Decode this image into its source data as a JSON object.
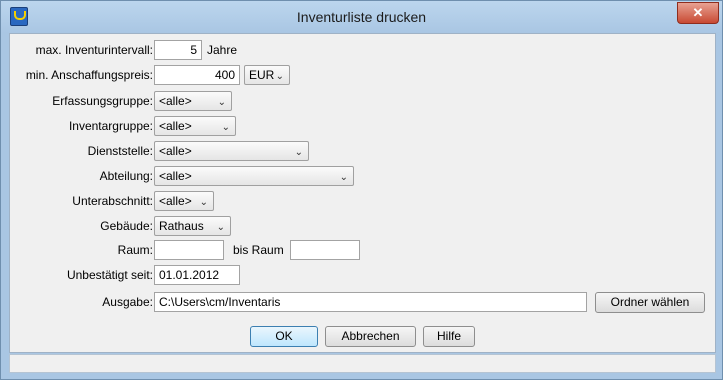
{
  "window": {
    "title": "Inventurliste drucken",
    "close_glyph": "✕"
  },
  "form": {
    "interval": {
      "label": "max. Inventurintervall:",
      "value": "5",
      "unit": "Jahre"
    },
    "price": {
      "label": "min. Anschaffungspreis:",
      "value": "400",
      "currency": "EUR"
    },
    "erfassungsgruppe": {
      "label": "Erfassungsgruppe:",
      "value": "<alle>"
    },
    "inventargruppe": {
      "label": "Inventargruppe:",
      "value": "<alle>"
    },
    "dienststelle": {
      "label": "Dienststelle:",
      "value": "<alle>"
    },
    "abteilung": {
      "label": "Abteilung:",
      "value": "<alle>"
    },
    "unterabschnitt": {
      "label": "Unterabschnitt:",
      "value": "<alle>"
    },
    "gebaeude": {
      "label": "Gebäude:",
      "value": "Rathaus"
    },
    "raum": {
      "label": "Raum:",
      "value": "",
      "bis_label": "bis Raum",
      "bis_value": ""
    },
    "unbestaetigt": {
      "label": "Unbestätigt seit:",
      "value": "01.01.2012"
    },
    "ausgabe": {
      "label": "Ausgabe:",
      "value": "C:\\Users\\cm/Inventaris",
      "folder_button": "Ordner wählen"
    }
  },
  "buttons": {
    "ok": "OK",
    "cancel": "Abbrechen",
    "help": "Hilfe"
  },
  "icons": {
    "dropdown": "chevron-down-icon",
    "app": "app-icon"
  }
}
